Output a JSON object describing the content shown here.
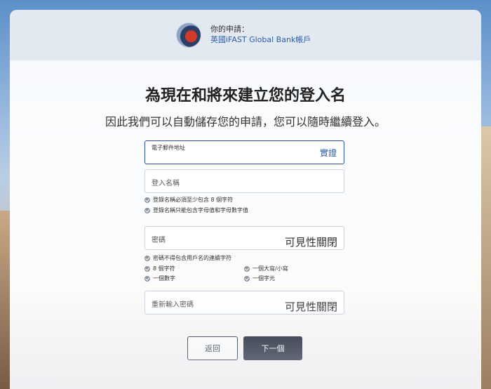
{
  "header": {
    "caption": "你的申請：",
    "application_name": "英國iFAST Global Bank帳戶"
  },
  "title": "為現在和將來建立您的登入名",
  "subtitle": "因此我們可以自動儲存您的申請，您可以隨時繼續登入。",
  "form": {
    "email": {
      "label": "電子郵件地址",
      "action": "實證"
    },
    "username": {
      "label": "登入名稱"
    },
    "username_rules": [
      "登錄名稱必須至少包含 8 個字符",
      "登錄名稱只能包含字母值和字母數字值"
    ],
    "password": {
      "label": "密碼",
      "toggle": "可見性關閉"
    },
    "password_rules": {
      "full": "密碼不得包含用戶名的連續字符",
      "left": [
        "8 個字符",
        "一個數字"
      ],
      "right": [
        "一個大寫/小寫",
        "一個字元"
      ]
    },
    "confirm_password": {
      "label": "重新輸入密碼",
      "toggle": "可見性關閉"
    }
  },
  "buttons": {
    "back": "返回",
    "next": "下一個"
  },
  "colors": {
    "accent": "#2b5da8",
    "primary_button": "#0d1526",
    "header_bg": "#e3e9f1"
  }
}
